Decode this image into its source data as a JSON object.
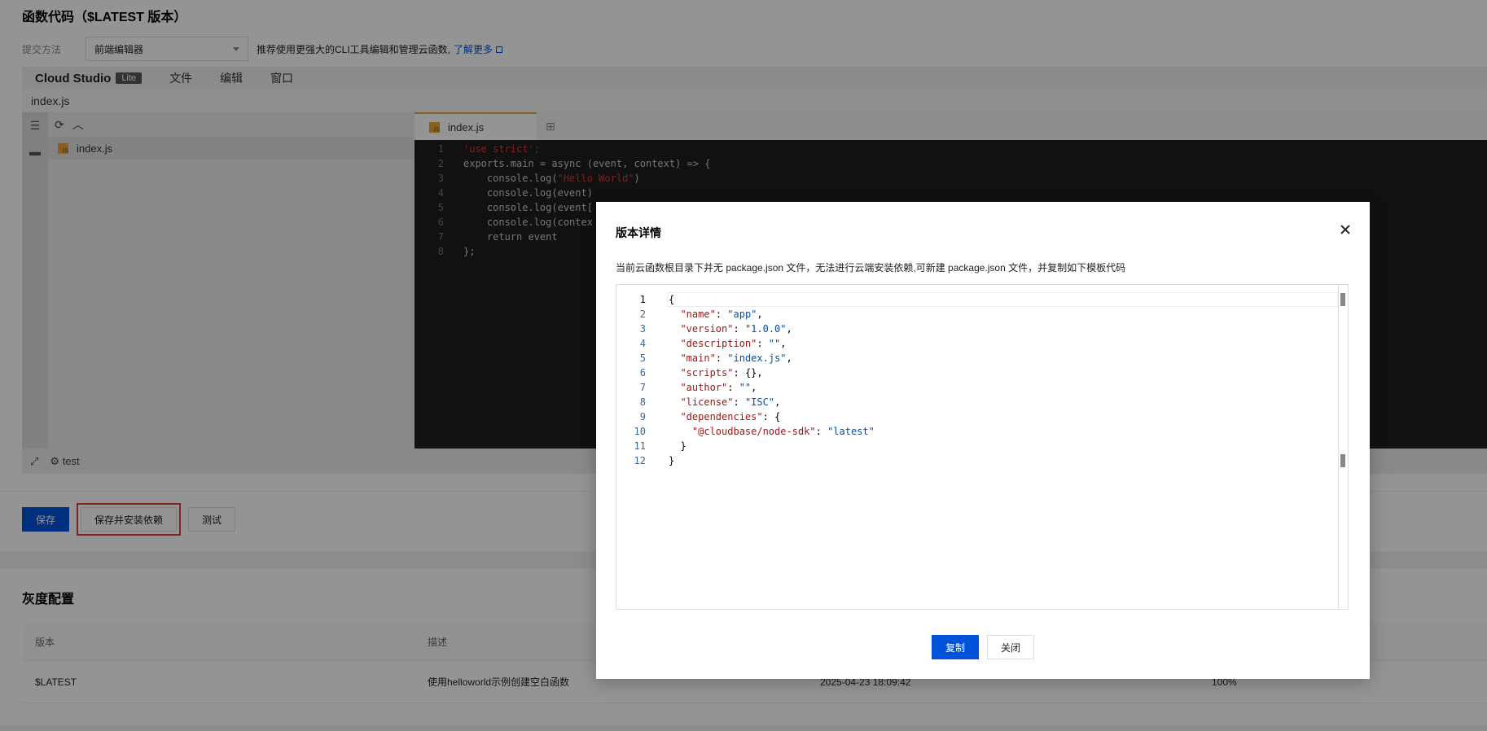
{
  "page": {
    "title": "函数代码（$LATEST 版本）",
    "submit_label": "提交方法",
    "submit_value": "前端编辑器",
    "submit_tip": "推荐使用更强大的CLI工具编辑和管理云函数,",
    "learn_more": "了解更多"
  },
  "ide": {
    "brand": "Cloud Studio",
    "lite": "Lite",
    "menus": [
      "文件",
      "编辑",
      "窗口"
    ],
    "file_path": "index.js",
    "explorer_file": "index.js",
    "tab_name": "index.js",
    "js_badge": "JS",
    "status_text": "test",
    "code": [
      {
        "n": "1",
        "text": "'use strict';"
      },
      {
        "n": "2",
        "text": "exports.main = async (event, context) => {"
      },
      {
        "n": "3",
        "pre": "    console.log(",
        "str": "\"Hello World\"",
        "post": ")"
      },
      {
        "n": "4",
        "text": "    console.log(event)"
      },
      {
        "n": "5",
        "text": "    console.log(event["
      },
      {
        "n": "6",
        "text": "    console.log(contex"
      },
      {
        "n": "7",
        "text": "    return event"
      },
      {
        "n": "8",
        "text": "};"
      }
    ]
  },
  "actions": {
    "save": "保存",
    "save_install": "保存并安装依赖",
    "test": "测试"
  },
  "gray_config": {
    "title": "灰度配置",
    "headers": [
      "版本",
      "描述",
      "",
      ""
    ],
    "rows": [
      {
        "version": "$LATEST",
        "desc": "使用helloworld示例创建空白函数",
        "time": "2025-04-23 18:09:42",
        "ratio": "100%"
      }
    ]
  },
  "modal": {
    "title": "版本详情",
    "description": "当前云函数根目录下并无 package.json 文件，无法进行云端安装依赖,可新建 package.json 文件，并复制如下模板代码",
    "copy_button": "复制",
    "close_button": "关闭",
    "json_lines": [
      {
        "n": "1",
        "indent": "",
        "key": "",
        "val": "",
        "pun": "{"
      },
      {
        "n": "2",
        "indent": "  ",
        "key": "\"name\"",
        "sep": ": ",
        "val": "\"app\"",
        "pun": ","
      },
      {
        "n": "3",
        "indent": "  ",
        "key": "\"version\"",
        "sep": ": ",
        "val": "\"1.0.0\"",
        "pun": ","
      },
      {
        "n": "4",
        "indent": "  ",
        "key": "\"description\"",
        "sep": ": ",
        "val": "\"\"",
        "pun": ","
      },
      {
        "n": "5",
        "indent": "  ",
        "key": "\"main\"",
        "sep": ": ",
        "val": "\"index.js\"",
        "pun": ","
      },
      {
        "n": "6",
        "indent": "  ",
        "key": "\"scripts\"",
        "sep": ": ",
        "val": "",
        "pun": "{},"
      },
      {
        "n": "7",
        "indent": "  ",
        "key": "\"author\"",
        "sep": ": ",
        "val": "\"\"",
        "pun": ","
      },
      {
        "n": "8",
        "indent": "  ",
        "key": "\"license\"",
        "sep": ": ",
        "val": "\"ISC\"",
        "pun": ","
      },
      {
        "n": "9",
        "indent": "  ",
        "key": "\"dependencies\"",
        "sep": ": ",
        "val": "",
        "pun": "{"
      },
      {
        "n": "10",
        "indent": "    ",
        "key": "\"@cloudbase/node-sdk\"",
        "sep": ": ",
        "val": "\"latest\"",
        "pun": ""
      },
      {
        "n": "11",
        "indent": "  ",
        "key": "",
        "val": "",
        "pun": "}"
      },
      {
        "n": "12",
        "indent": "",
        "key": "",
        "val": "",
        "pun": "}"
      }
    ]
  },
  "colors": {
    "primary": "#0052d9",
    "highlight": "#e53935",
    "json_key": "#a31515",
    "json_value": "#0451a5"
  }
}
